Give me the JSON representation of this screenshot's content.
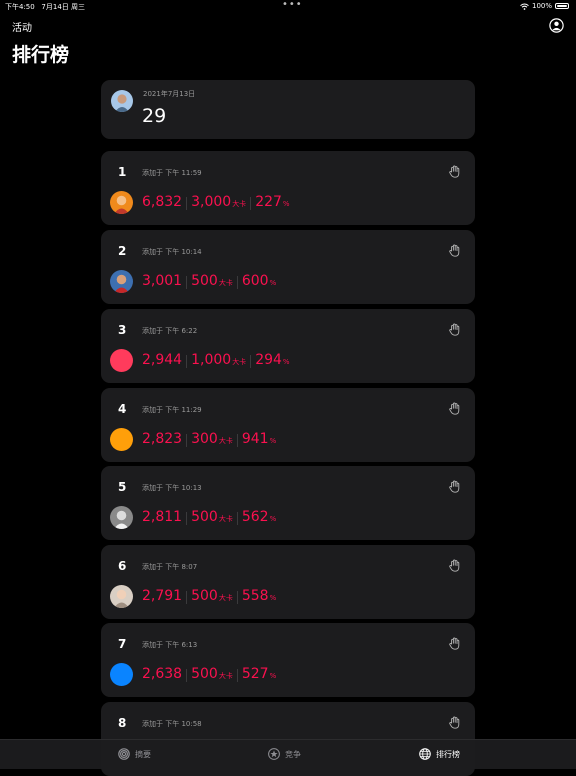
{
  "status": {
    "time": "下午4:50",
    "date": "7月14日 周三",
    "battery": "100%"
  },
  "nav": {
    "back": "活动",
    "title": "排行榜"
  },
  "summary": {
    "date": "2021年7月13日",
    "value": "29"
  },
  "added_prefix": "添加于",
  "units": {
    "calories": "大卡",
    "percent": "%"
  },
  "entries": [
    {
      "rank": "1",
      "time": "下午 11:59",
      "points": "6,832",
      "calories": "3,000",
      "percent": "227",
      "avatar": "photo-orange"
    },
    {
      "rank": "2",
      "time": "下午 10:14",
      "points": "3,001",
      "calories": "500",
      "percent": "600",
      "avatar": "photo-red-blue"
    },
    {
      "rank": "3",
      "time": "下午 6:22",
      "points": "2,944",
      "calories": "1,000",
      "percent": "294",
      "avatar": "red-dot"
    },
    {
      "rank": "4",
      "time": "下午 11:29",
      "points": "2,823",
      "calories": "300",
      "percent": "941",
      "avatar": "orange-dot"
    },
    {
      "rank": "5",
      "time": "下午 10:13",
      "points": "2,811",
      "calories": "500",
      "percent": "562",
      "avatar": "photo-gray"
    },
    {
      "rank": "6",
      "time": "下午 8:07",
      "points": "2,791",
      "calories": "500",
      "percent": "558",
      "avatar": "photo-light"
    },
    {
      "rank": "7",
      "time": "下午 6:13",
      "points": "2,638",
      "calories": "500",
      "percent": "527",
      "avatar": "blue-dot"
    },
    {
      "rank": "8",
      "time": "下午 10:58"
    }
  ],
  "tabs": [
    {
      "label": "摘要",
      "icon": "activity-rings-icon",
      "active": false
    },
    {
      "label": "竞争",
      "icon": "star-badge-icon",
      "active": false
    },
    {
      "label": "排行榜",
      "icon": "globe-icon",
      "active": true
    }
  ],
  "colors": {
    "accent": "#fa114f",
    "card": "#1c1c1e",
    "background": "#000000"
  }
}
